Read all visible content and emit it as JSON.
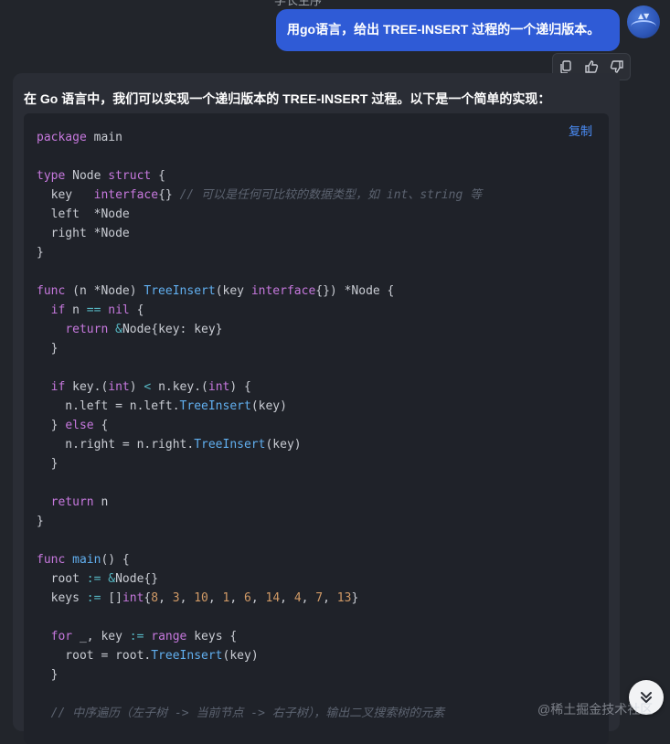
{
  "top_fragment": "学长生序",
  "user_message": "用go语言，给出 TREE-INSERT 过程的一个递归版本。",
  "answer": {
    "intro": "在 Go 语言中，我们可以实现一个递归版本的 TREE-INSERT 过程。以下是一个简单的实现：",
    "copy_label": "复制",
    "code_lines": [
      "package main",
      "",
      "type Node struct {",
      "  key   interface{} // 可以是任何可比较的数据类型，如 int、string 等",
      "  left  *Node",
      "  right *Node",
      "}",
      "",
      "func (n *Node) TreeInsert(key interface{}) *Node {",
      "  if n == nil {",
      "    return &Node{key: key}",
      "  }",
      "",
      "  if key.(int) < n.key.(int) {",
      "    n.left = n.left.TreeInsert(key)",
      "  } else {",
      "    n.right = n.right.TreeInsert(key)",
      "  }",
      "",
      "  return n",
      "}",
      "",
      "func main() {",
      "  root := &Node{}",
      "  keys := []int{8, 3, 10, 1, 6, 14, 4, 7, 13}",
      "",
      "  for _, key := range keys {",
      "    root = root.TreeInsert(key)",
      "  }",
      "",
      "  // 中序遍历（左子树 -> 当前节点 -> 右子树），输出二叉搜索树的元素"
    ]
  },
  "actions": {
    "copy_icon": "copy-icon",
    "like_icon": "thumbs-up-icon",
    "dislike_icon": "thumbs-down-icon"
  },
  "watermark": "@稀土掘金技术社区",
  "colors": {
    "background": "#22252b",
    "user_bubble": "#2f5bd6",
    "card": "#2a2d35",
    "code_bg": "#1f2229",
    "copy_link": "#4b8df8"
  }
}
